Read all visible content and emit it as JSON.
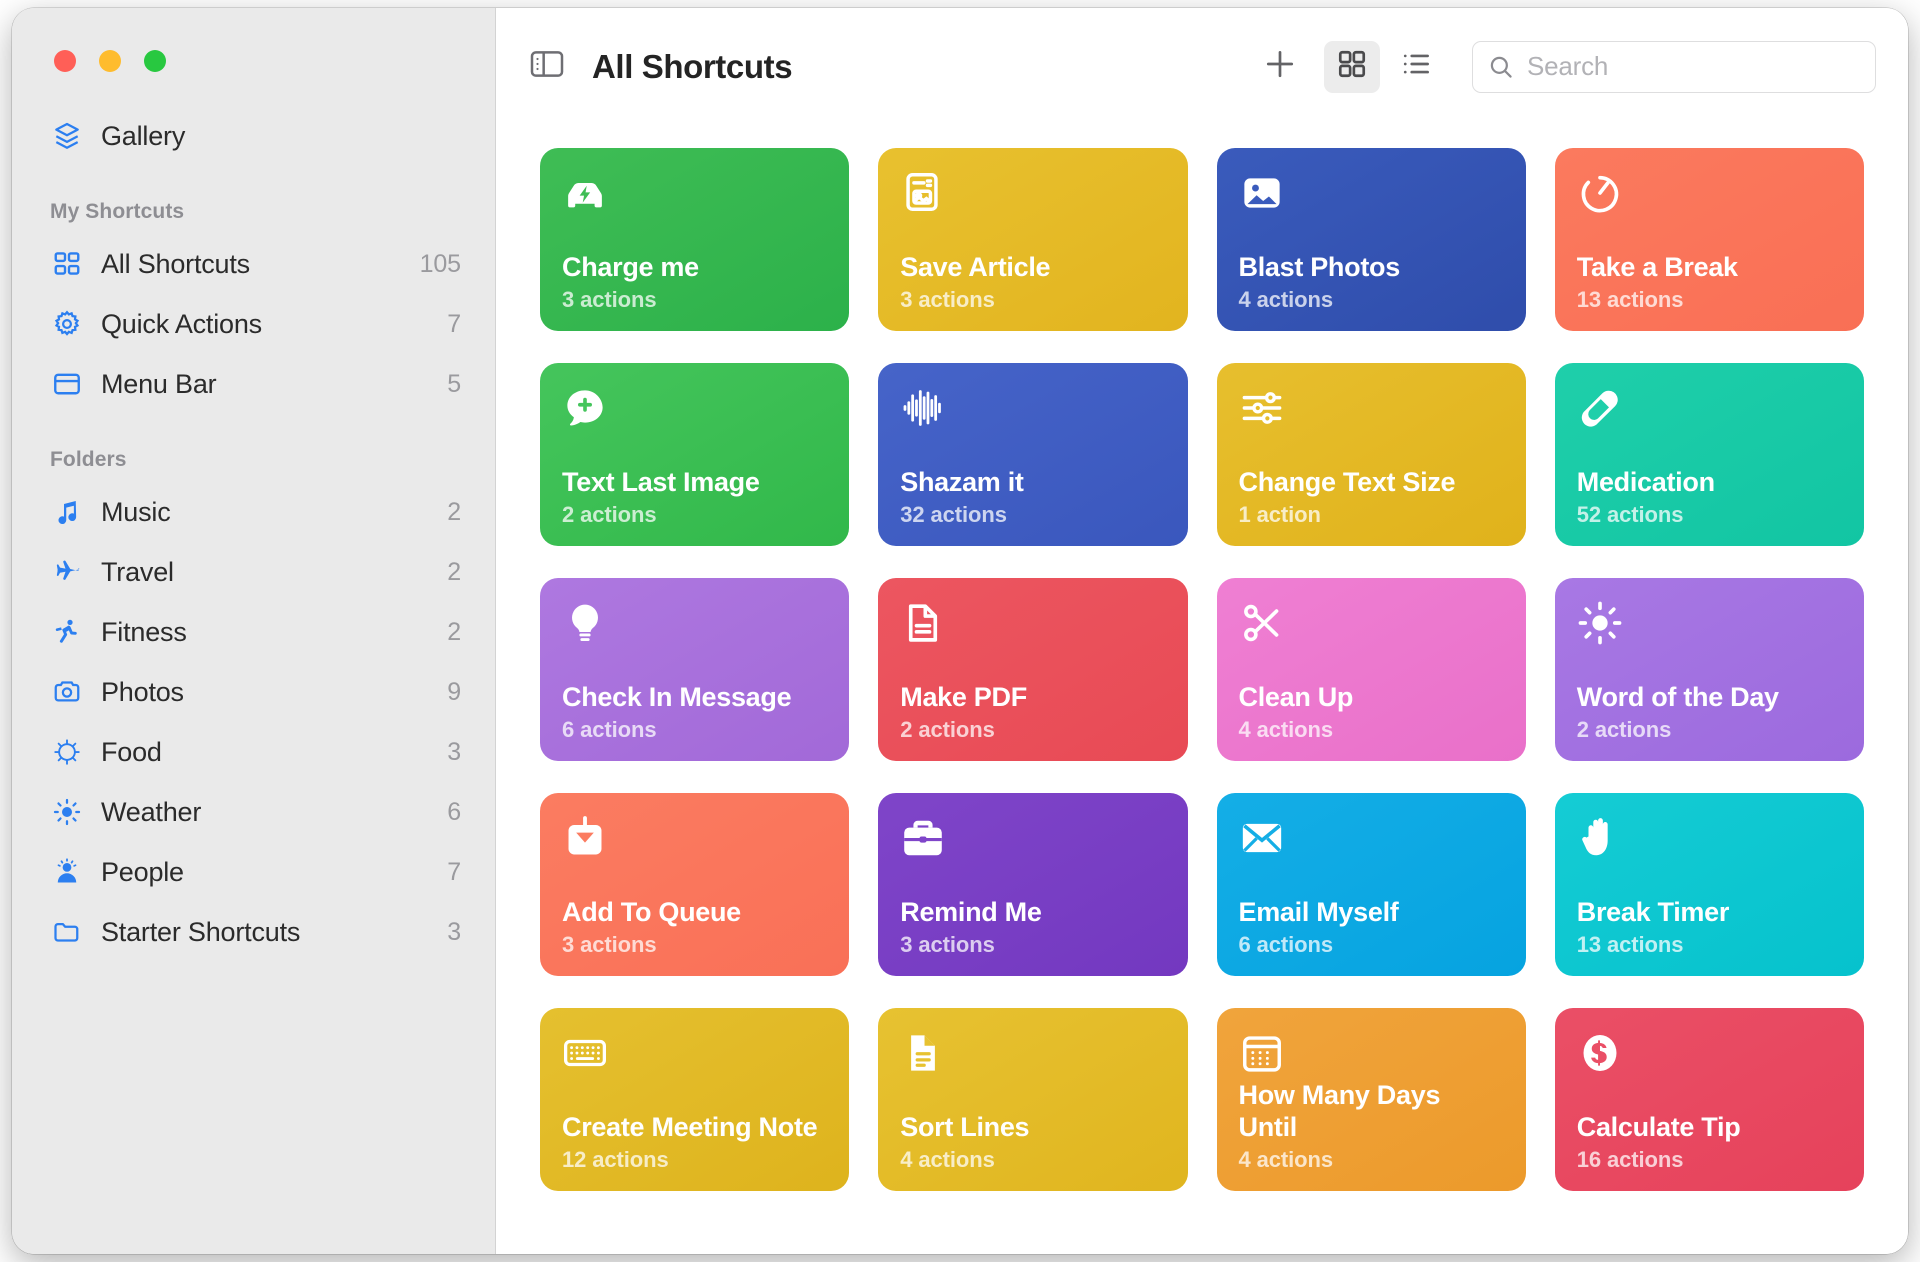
{
  "window": {
    "traffic_lights": [
      "close",
      "minimize",
      "zoom"
    ]
  },
  "sidebar": {
    "gallery": {
      "label": "Gallery",
      "icon": "gallery-layers-icon"
    },
    "sections": [
      {
        "title": "My Shortcuts",
        "items": [
          {
            "label": "All Shortcuts",
            "count": "105",
            "icon": "grid-icon"
          },
          {
            "label": "Quick Actions",
            "count": "7",
            "icon": "gear-icon"
          },
          {
            "label": "Menu Bar",
            "count": "5",
            "icon": "menubar-icon"
          }
        ]
      },
      {
        "title": "Folders",
        "items": [
          {
            "label": "Music",
            "count": "2",
            "icon": "music-note-icon"
          },
          {
            "label": "Travel",
            "count": "2",
            "icon": "airplane-icon"
          },
          {
            "label": "Fitness",
            "count": "2",
            "icon": "running-person-icon"
          },
          {
            "label": "Photos",
            "count": "9",
            "icon": "camera-icon"
          },
          {
            "label": "Food",
            "count": "3",
            "icon": "fork-circle-icon"
          },
          {
            "label": "Weather",
            "count": "6",
            "icon": "sun-icon"
          },
          {
            "label": "People",
            "count": "7",
            "icon": "person-icon"
          },
          {
            "label": "Starter Shortcuts",
            "count": "3",
            "icon": "folder-icon"
          }
        ]
      }
    ]
  },
  "toolbar": {
    "sidebar_toggle_icon": "sidebar-toggle-icon",
    "title": "All Shortcuts",
    "add_label": "+",
    "grid_view_icon": "grid-view-icon",
    "list_view_icon": "list-view-icon",
    "search_placeholder": "Search",
    "search_value": ""
  },
  "colors": {
    "accent": "#2c7ff0",
    "sidebar_bg": "#eaeaea",
    "content_bg": "#ffffff"
  },
  "grid": {
    "cards": [
      {
        "name": "Charge me",
        "actions": "3 actions",
        "icon": "car-bolt-icon",
        "c1": "#3fbd55",
        "c2": "#2cb14a"
      },
      {
        "name": "Save Article",
        "actions": "3 actions",
        "icon": "article-icon",
        "c1": "#e8c12f",
        "c2": "#e2b41f"
      },
      {
        "name": "Blast Photos",
        "actions": "4 actions",
        "icon": "photo-icon",
        "c1": "#3a5bbc",
        "c2": "#2f4dab"
      },
      {
        "name": "Take a Break",
        "actions": "13 actions",
        "icon": "stopwatch-icon",
        "c1": "#fb7a5e",
        "c2": "#f96f55"
      },
      {
        "name": "Text Last Image",
        "actions": "2 actions",
        "icon": "message-plus-icon",
        "c1": "#45c55c",
        "c2": "#31b84a"
      },
      {
        "name": "Shazam it",
        "actions": "32 actions",
        "icon": "waveform-icon",
        "c1": "#4664c9",
        "c2": "#3a57bd"
      },
      {
        "name": "Change Text Size",
        "actions": "1 action",
        "icon": "sliders-icon",
        "c1": "#e7bf2e",
        "c2": "#e0b21b"
      },
      {
        "name": "Medication",
        "actions": "52 actions",
        "icon": "pill-icon",
        "c1": "#1fcfaa",
        "c2": "#12c5a3"
      },
      {
        "name": "Check In Message",
        "actions": "6 actions",
        "icon": "lightbulb-icon",
        "c1": "#ae78e0",
        "c2": "#a269d8"
      },
      {
        "name": "Make PDF",
        "actions": "2 actions",
        "icon": "document-icon",
        "c1": "#ec5660",
        "c2": "#e84a55"
      },
      {
        "name": "Clean Up",
        "actions": "4 actions",
        "icon": "scissors-icon",
        "c1": "#ef7fd3",
        "c2": "#e970c9"
      },
      {
        "name": "Word of the Day",
        "actions": "2 actions",
        "icon": "sun-rays-icon",
        "c1": "#a878e4",
        "c2": "#9c6ade"
      },
      {
        "name": "Add To Queue",
        "actions": "3 actions",
        "icon": "download-box-icon",
        "c1": "#fb7c61",
        "c2": "#f97057"
      },
      {
        "name": "Remind Me",
        "actions": "3 actions",
        "icon": "briefcase-icon",
        "c1": "#7f45c9",
        "c2": "#7338c0"
      },
      {
        "name": "Email Myself",
        "actions": "6 actions",
        "icon": "envelope-icon",
        "c1": "#14aee6",
        "c2": "#06a3e0"
      },
      {
        "name": "Break Timer",
        "actions": "13 actions",
        "icon": "hand-raised-icon",
        "c1": "#15ccd4",
        "c2": "#06c2cd"
      },
      {
        "name": "Create Meeting Note",
        "actions": "12 actions",
        "icon": "keyboard-icon",
        "c1": "#e5c02f",
        "c2": "#deb31d"
      },
      {
        "name": "Sort Lines",
        "actions": "4 actions",
        "icon": "document-lines-icon",
        "c1": "#e7c231",
        "c2": "#e0b51f"
      },
      {
        "name": "How Many Days Until",
        "actions": "4 actions",
        "icon": "calendar-icon",
        "c1": "#f0a43c",
        "c2": "#ec9a2b"
      },
      {
        "name": "Calculate Tip",
        "actions": "16 actions",
        "icon": "dollar-circle-icon",
        "c1": "#ea4f66",
        "c2": "#e6425b"
      }
    ]
  }
}
